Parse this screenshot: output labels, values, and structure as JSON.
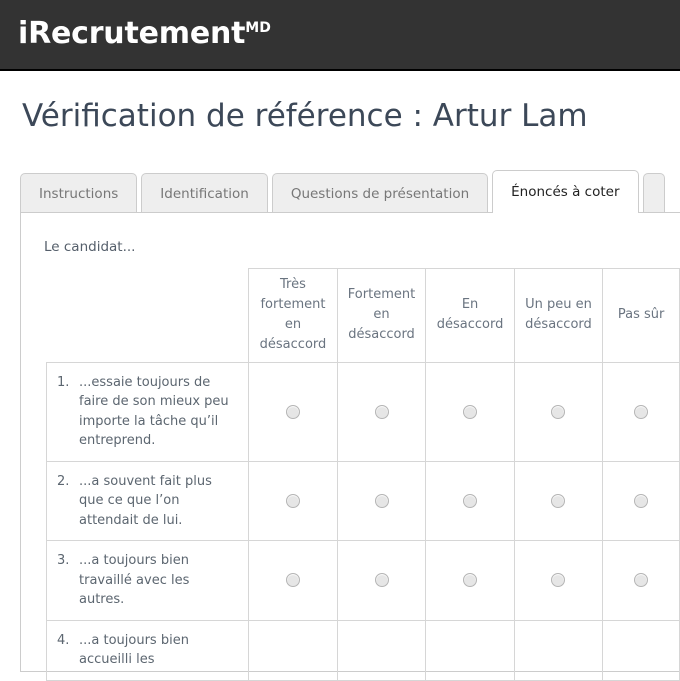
{
  "header": {
    "brand_name": "iRecrutement",
    "brand_superscript": "MD",
    "bar_color": "#333333"
  },
  "page": {
    "title": "Vérification de référence : Artur Lam"
  },
  "tabs": [
    {
      "label": "Instructions",
      "active": false
    },
    {
      "label": "Identification",
      "active": false
    },
    {
      "label": "Questions de présentation",
      "active": false
    },
    {
      "label": "Énoncés à coter",
      "active": true
    },
    {
      "label": "",
      "active": false
    }
  ],
  "panel": {
    "intro": "Le candidat..."
  },
  "grid": {
    "row_header_blank": "",
    "scale_columns": [
      "Très fortement en désaccord",
      "Fortement en désaccord",
      "En désaccord",
      "Un peu en désaccord",
      "Pas sûr"
    ],
    "rows": [
      {
        "number": "1.",
        "text": "...essaie toujours de faire de son mieux peu importe la tâche qu’il entreprend."
      },
      {
        "number": "2.",
        "text": "...a souvent fait plus que ce que l’on attendait de lui."
      },
      {
        "number": "3.",
        "text": "...a toujours bien travaillé avec les autres."
      },
      {
        "number": "4.",
        "text": "...a toujours bien accueilli les"
      }
    ],
    "radio_state": "unselected"
  },
  "colors": {
    "header_bar": "#333333",
    "title_text": "#3c4858",
    "body_text": "#5c6670",
    "tab_inactive_bg": "#eeeeee",
    "tab_active_bg": "#ffffff",
    "border": "#cccccc",
    "grid_border": "#d6d6d6"
  }
}
